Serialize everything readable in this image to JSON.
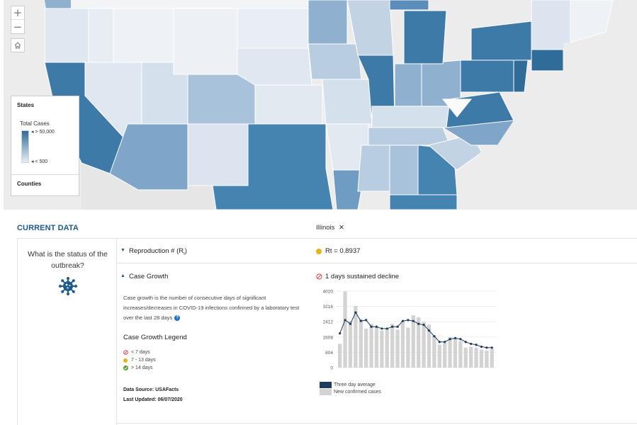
{
  "map": {
    "zoom_in_icon": "plus-icon",
    "zoom_out_icon": "minus-icon",
    "home_icon": "home-icon",
    "legend": {
      "title": "States",
      "subtitle": "Total Cases",
      "high_label": "> 50,000",
      "low_label": "< 500",
      "counties_label": "Counties"
    },
    "colors": {
      "dark": "#2f6c9a",
      "mid": "#6f9cc2",
      "light": "#c8d7e6",
      "pale": "#e7edf4",
      "background": "#ececec"
    }
  },
  "current_data": {
    "title": "CURRENT DATA",
    "region": "Illinois",
    "close_symbol": "✕"
  },
  "status": {
    "question": "What is the status of the outbreak?",
    "icon": "virus-icon"
  },
  "reproduction": {
    "label_prefix": "Reproduction # (R",
    "label_sub": "t",
    "label_suffix": ")",
    "value": "Rt = 0.8937",
    "status_color": "#e7b416"
  },
  "case_growth": {
    "label": "Case Growth",
    "status": "1 days sustained decline",
    "status_icon": "no-entry-icon",
    "description": "Case growth is the number of consecutive days of significant increases/decreases in COVID-19 infections confirmed by a laboratory test over the last 28 days",
    "legend_title": "Case Growth Legend",
    "legend_items": [
      {
        "label": "< 7 days",
        "icon": "no-entry-icon",
        "color": "#d9534f"
      },
      {
        "label": "7 - 13 days",
        "icon": "yellow-dot-icon",
        "color": "#e7b416"
      },
      {
        "label": "> 14 days",
        "icon": "check-circle-icon",
        "color": "#5a9e2f"
      }
    ],
    "data_source": "Data Source: USAFacts",
    "last_updated": "Last Updated: 06/07/2020"
  },
  "chart_data": {
    "type": "bar",
    "y_ticks": [
      "4020",
      "3216",
      "2412",
      "1608",
      "804",
      "0"
    ],
    "ylim": [
      0,
      4020
    ],
    "grid": true,
    "series": [
      {
        "name": "New confirmed cases",
        "color": "#d3d3d3",
        "values": [
          1250,
          4000,
          2450,
          3250,
          2550,
          2050,
          2300,
          2150,
          1950,
          2050,
          2300,
          2000,
          2450,
          2100,
          2750,
          2650,
          2400,
          2250,
          1700,
          1200,
          1300,
          1600,
          1550,
          1400,
          1050,
          1100,
          1050,
          950,
          900,
          1000
        ]
      },
      {
        "name": "Three day average",
        "color": "#1f3b5c",
        "values": [
          1800,
          2500,
          2300,
          2900,
          2450,
          2500,
          2150,
          2150,
          2050,
          2050,
          2150,
          2150,
          2450,
          2500,
          2450,
          2300,
          2250,
          1950,
          1650,
          1350,
          1350,
          1500,
          1550,
          1500,
          1350,
          1250,
          1200,
          1100,
          1050,
          1050
        ]
      }
    ],
    "legend": [
      "Three day average",
      "New confirmed cases"
    ],
    "legend_placement": "bottom-left"
  }
}
